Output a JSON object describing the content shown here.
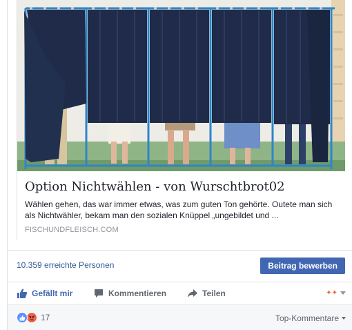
{
  "preview": {
    "headline": "Option Nichtwählen - von Wurschtbrot02",
    "description": "Wählen gehen, das war immer etwas, was zum guten Ton gehörte. Outete man sich als Nichtwähler, bekam man den sozialen Knüppel „ungebildet und ...",
    "source": "FISCHUNDFLEISCH.COM"
  },
  "reach": {
    "text": "10.359 erreichte Personen",
    "boost_label": "Beitrag bewerben"
  },
  "actions": {
    "like": "Gefällt mir",
    "comment": "Kommentieren",
    "share": "Teilen"
  },
  "reactions": {
    "count": "17",
    "sort_label": "Top-Kommentare"
  },
  "colors": {
    "link": "#365899",
    "brand": "#4267b2",
    "curtain": "#1f2b48"
  }
}
